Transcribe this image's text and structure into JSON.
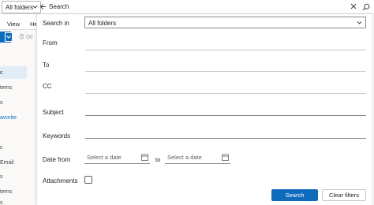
{
  "topbar": {
    "scope": "All folders",
    "search_placeholder": "Search"
  },
  "background": {
    "tabs": [
      "View",
      "He"
    ],
    "delete_label": "De",
    "folders": [
      "c",
      "tems",
      "s",
      "avorite",
      "c",
      "Email",
      "s",
      "tems",
      "s"
    ]
  },
  "form": {
    "search_in_label": "Search in",
    "search_in_value": "All folders",
    "from_label": "From",
    "to_label": "To",
    "cc_label": "CC",
    "subject_label": "Subject",
    "keywords_label": "Keywords",
    "date_from_label": "Date from",
    "date_placeholder_start": "Select a date",
    "date_to_label": "to",
    "date_placeholder_end": "Select a date",
    "attachments_label": "Attachments"
  },
  "buttons": {
    "search": "Search",
    "clear": "Clear filters"
  },
  "colors": {
    "accent": "#0f6cbd",
    "selected_bg": "#e1ecf7"
  },
  "icons": {
    "scope_chevron": "chevron-down-icon",
    "back": "arrow-left-icon",
    "close": "close-icon",
    "search": "search-icon",
    "calendar": "calendar-icon"
  }
}
